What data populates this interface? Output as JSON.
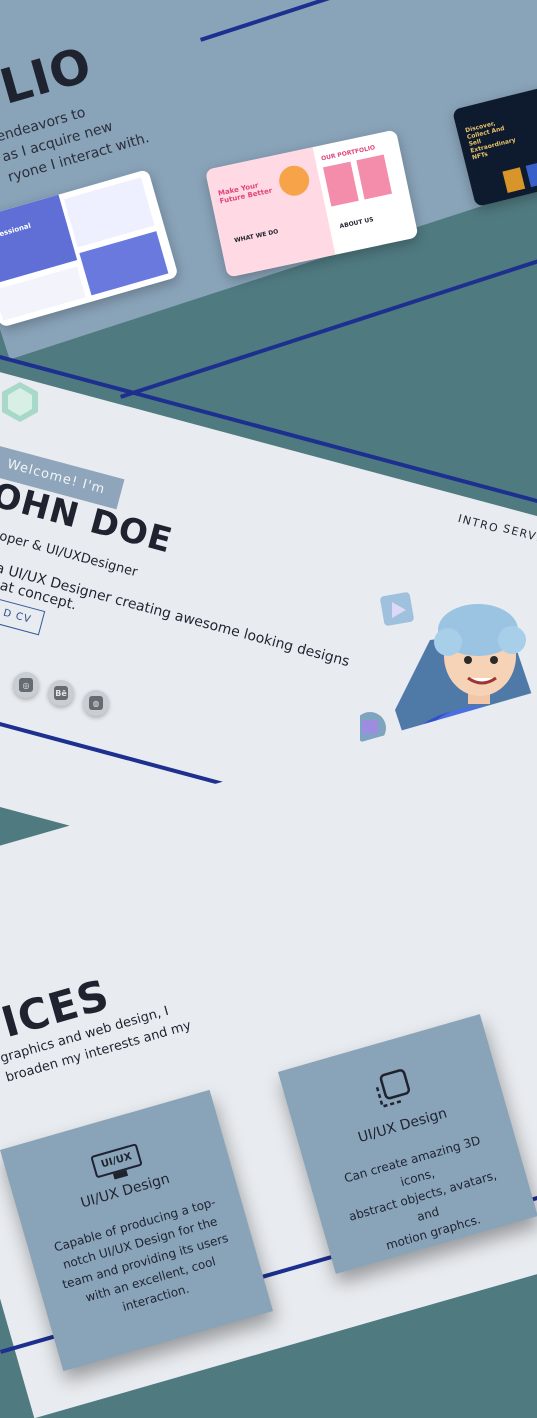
{
  "portfolio": {
    "title_fragment": "LIO",
    "intro_lines": [
      "endeavors to",
      "as I acquire new",
      "ryone I interact with."
    ],
    "thumbnails": [
      {
        "name": "agency-site",
        "label": "Professional"
      },
      {
        "name": "pink-portfolio",
        "headline": "Make Your Future Better",
        "section1": "OUR PORTFOLIO",
        "section2": "WHAT WE DO",
        "section3": "ABOUT US"
      },
      {
        "name": "dark-nft",
        "headline": "Discover, Collect And Sell Extraordinary NFTs"
      }
    ]
  },
  "hero": {
    "welcome": "Welcome! I'm",
    "name": "OHN DOE",
    "role": "loper & UI/UXDesigner",
    "desc_line1": "a UI/UX Designer creating awesome looking designs",
    "desc_line2": "eat concept.",
    "cv_button": "D CV",
    "nav": [
      "INTRO",
      "SERVIC"
    ],
    "socials": [
      "instagram-icon",
      "behance-icon",
      "dribbble-icon"
    ],
    "social_labels": [
      "◎",
      "Bē",
      "◍"
    ]
  },
  "services": {
    "title": "ICES",
    "intro_line1": "graphics and web design, I",
    "intro_line2": "broaden my interests and my",
    "cards": [
      {
        "icon": "monitor-icon",
        "icon_text": "UI/UX",
        "title": "UI/UX Design",
        "desc": [
          "Capable of producing a top-",
          "notch UI/UX Design for the",
          "team and providing its users",
          "with an excellent, cool",
          "interaction."
        ]
      },
      {
        "icon": "select-frame-icon",
        "title": "UI/UX Design",
        "desc": [
          "Can create amazing 3D icons,",
          "abstract objects, avatars, and",
          "motion graphcs."
        ]
      }
    ]
  },
  "colors": {
    "band_blue": "#89a3b9",
    "background_teal": "#4f7a80",
    "light": "#e8ebef",
    "accent_line": "#1d2f8f"
  }
}
